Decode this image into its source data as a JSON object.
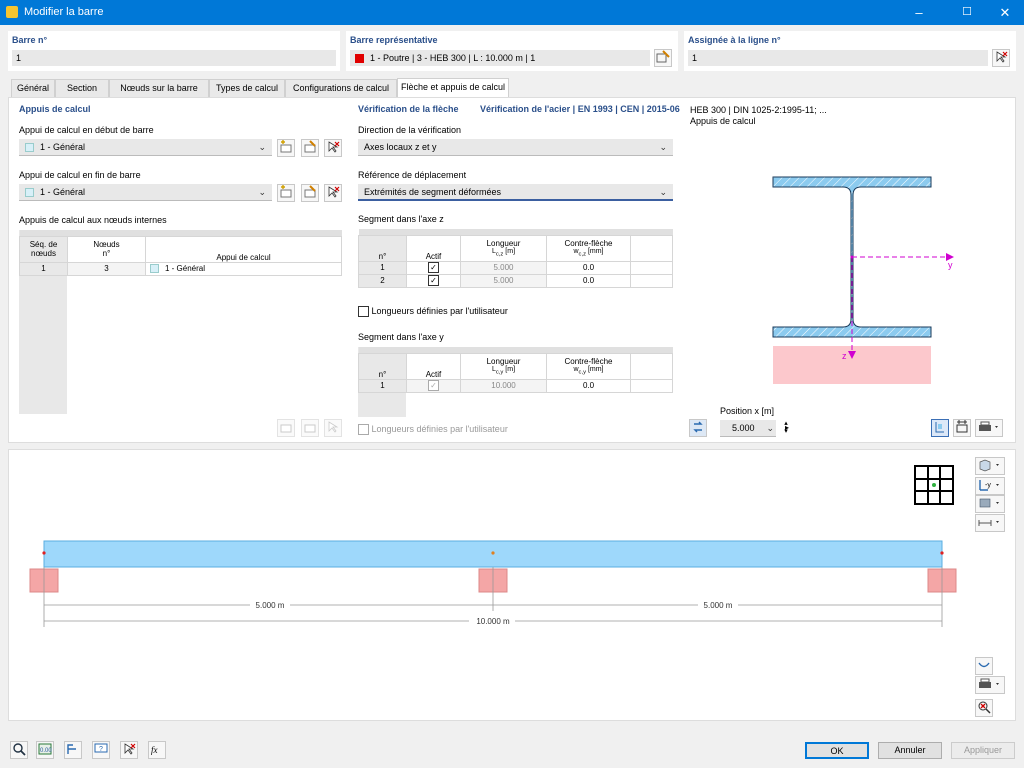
{
  "window": {
    "title": "Modifier la barre",
    "minimize": "–",
    "maximize": "☐",
    "close": "✕"
  },
  "header": {
    "member_no_label": "Barre n°",
    "member_no_value": "1",
    "representative_label": "Barre représentative",
    "representative_value": "1 - Poutre | 3 - HEB 300 | L : 10.000 m | 1",
    "representative_color": "#e00000",
    "assigned_label": "Assignée à la ligne n°",
    "assigned_value": "1"
  },
  "tabs": [
    "Général",
    "Section",
    "Nœuds sur la barre",
    "Types de calcul",
    "Configurations de calcul",
    "Flèche et appuis de calcul"
  ],
  "active_tab": "Flèche et appuis de calcul",
  "left": {
    "title": "Appuis de calcul",
    "start_label": "Appui de calcul en début de barre",
    "start_value": "1 - Général",
    "end_label": "Appui de calcul en fin de barre",
    "end_value": "1 - Général",
    "internal_label": "Appuis de calcul aux nœuds internes",
    "table": {
      "col1": "Séq. de nœuds",
      "col2a": "Nœuds",
      "col2b": "n°",
      "col3": "Appui de calcul",
      "rows": [
        {
          "seq": "1",
          "node": "3",
          "support": "1 - Général"
        }
      ]
    },
    "swatch_color": "#d8f0f8"
  },
  "middle": {
    "title": "Vérification de la flèche",
    "subtitle": "Vérification de l'acier | EN 1993 | CEN | 2015-06",
    "direction_label": "Direction de la vérification",
    "direction_value": "Axes locaux z et y",
    "reference_label": "Référence de déplacement",
    "reference_value": "Extrémités de segment déformées",
    "seg_z_label": "Segment dans l'axe z",
    "seg_z_table": {
      "h_no": "n°",
      "h_active": "Actif",
      "h_len": "Longueur",
      "h_len_unit_main": "L",
      "h_len_unit_sub": "c,z",
      "h_len_unit": " [m]",
      "h_camber": "Contre-flèche",
      "h_camber_main": "w",
      "h_camber_sub": "c,z",
      "h_camber_unit": " [mm]",
      "rows": [
        {
          "no": "1",
          "active": "✓",
          "length": "5.000",
          "camber": "0.0"
        },
        {
          "no": "2",
          "active": "✓",
          "length": "5.000",
          "camber": "0.0"
        }
      ]
    },
    "user_len_z": "Longueurs définies par l'utilisateur",
    "seg_y_label": "Segment dans l'axe y",
    "seg_y_table": {
      "h_no": "n°",
      "h_active": "Actif",
      "h_len": "Longueur",
      "h_len_unit_main": "L",
      "h_len_unit_sub": "c,y",
      "h_len_unit": " [m]",
      "h_camber": "Contre-flèche",
      "h_camber_main": "w",
      "h_camber_sub": "c,y",
      "h_camber_unit": " [mm]",
      "rows": [
        {
          "no": "1",
          "active": "✓",
          "length": "10.000",
          "camber": "0.0"
        }
      ]
    },
    "user_len_y": "Longueurs définies par l'utilisateur"
  },
  "right": {
    "section_title": "HEB 300 | DIN 1025-2:1995-11; ...",
    "section_subtitle": "Appuis de calcul",
    "axis_y": "y",
    "axis_z": "z",
    "position_label": "Position x [m]",
    "position_value": "5.000",
    "section_fill": "#8ccbef",
    "support_fill": "#fcc8cc",
    "axis_color": "#d000d0"
  },
  "diagram": {
    "dim_left": "5.000 m",
    "dim_right": "5.000 m",
    "dim_total": "10.000 m",
    "beam_fill": "#9ed8fb",
    "support_fill": "#f4a6a6",
    "node_color": "#e02020"
  },
  "footer": {
    "ok": "OK",
    "cancel": "Annuler",
    "apply": "Appliquer"
  }
}
